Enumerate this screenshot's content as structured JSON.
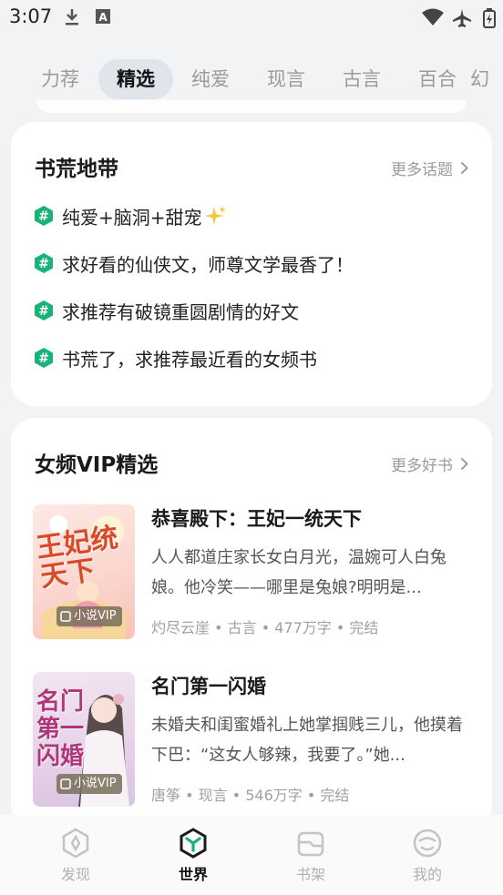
{
  "status_bar": {
    "time": "3:07"
  },
  "tabs": [
    {
      "label": "力荐"
    },
    {
      "label": "精选"
    },
    {
      "label": "纯爱"
    },
    {
      "label": "现言"
    },
    {
      "label": "古言"
    },
    {
      "label": "百合"
    },
    {
      "label": "幻"
    }
  ],
  "active_tab": "精选",
  "topics_card": {
    "title": "书荒地带",
    "more_label": "更多话题",
    "topics": [
      {
        "text": "纯爱+脑洞+甜宠"
      },
      {
        "text": "求好看的仙侠文，师尊文学最香了！"
      },
      {
        "text": "求推荐有破镜重圆剧情的好文"
      },
      {
        "text": "书荒了，求推荐最近看的女频书"
      }
    ]
  },
  "vip_card": {
    "title": "女频VIP精选",
    "more_label": "更多好书",
    "books": [
      {
        "title": "恭喜殿下：王妃一统天下",
        "description": "人人都道庄家长女白月光，温婉可人白兔娘。他冷笑——哪里是兔娘?明明是...",
        "meta": "灼尽云崖 • 古言 • 477万字 • 完结",
        "badge": "小说VIP",
        "cover_title": "王妃统天下"
      },
      {
        "title": "名门第一闪婚",
        "description": "未婚夫和闺蜜婚礼上她掌掴贱三儿，他摸着下巴：“这女人够辣，我要了。”她...",
        "meta": "唐筝 • 现言 • 546万字 • 完结",
        "badge": "小说VIP",
        "cover_title": "名门第一闪婚"
      }
    ]
  },
  "bottom_nav": [
    {
      "label": "发现",
      "icon": "discover-icon"
    },
    {
      "label": "世界",
      "icon": "world-icon"
    },
    {
      "label": "书架",
      "icon": "bookshelf-icon"
    },
    {
      "label": "我的",
      "icon": "profile-icon"
    }
  ],
  "colors": {
    "accent": "#19b37a",
    "active_tab_bg": "#e0e5ec",
    "page_bg": "#f2f3f5"
  }
}
